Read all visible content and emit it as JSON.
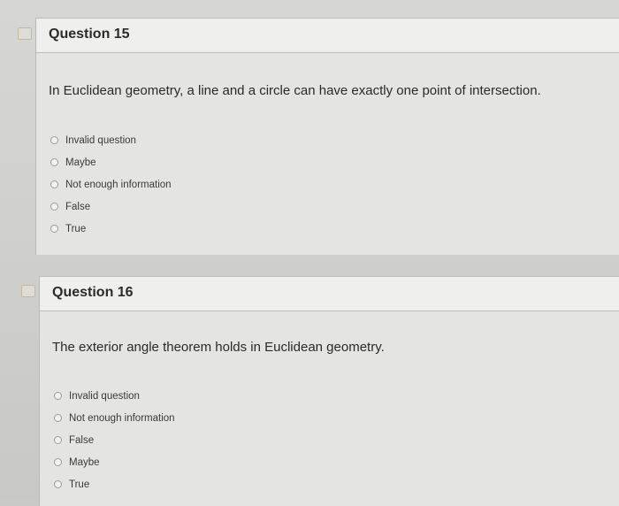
{
  "questions": [
    {
      "title": "Question 15",
      "text": "In Euclidean geometry, a line and a circle can have exactly one point of intersection.",
      "options": [
        "Invalid question",
        "Maybe",
        "Not enough information",
        "False",
        "True"
      ]
    },
    {
      "title": "Question 16",
      "text": "The exterior angle theorem holds in Euclidean geometry.",
      "options": [
        "Invalid question",
        "Not enough information",
        "False",
        "Maybe",
        "True"
      ]
    }
  ],
  "colors": {
    "header_background": "#efefed",
    "body_background": "#e4e4e2",
    "text": "#2a2a2a"
  },
  "icons": {
    "option_control": "radio-button-icon",
    "side_marker": "question-flag-icon"
  }
}
